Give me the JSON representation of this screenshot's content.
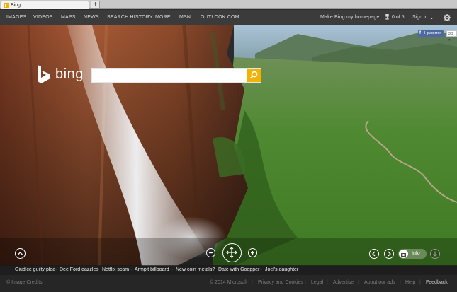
{
  "browser": {
    "tab_title": "Bing",
    "new_tab_label": "+"
  },
  "nav": {
    "items": [
      "IMAGES",
      "VIDEOS",
      "MAPS",
      "NEWS",
      "SEARCH HISTORY",
      "MORE",
      "MSN",
      "OUTLOOK.COM"
    ],
    "homepage_link": "Make Bing my homepage",
    "rewards": "0 of 5",
    "signin": "Sign in",
    "signin_chevron": "⌄",
    "settings_icon": "gear-icon"
  },
  "logo": {
    "word": "bing"
  },
  "search": {
    "value": "",
    "placeholder": ""
  },
  "social": {
    "fb_label": "Нравится",
    "fb_count": "3,9 т"
  },
  "controls": {
    "info_label": "Info"
  },
  "headlines": [
    "Giudice guilty plea",
    "Dee Ford dazzles",
    "Netflix scam",
    "Armpit billboard",
    "New coin metals?",
    "Date with Goepper",
    "Joel's daughter"
  ],
  "footer": {
    "image_credits": "© Image Credits",
    "links": [
      "© 2014 Microsoft",
      "Privacy and Cookies",
      "Legal",
      "Advertise",
      "About our ads",
      "Help"
    ],
    "feedback": "Feedback"
  },
  "colors": {
    "nav_bg": "#3b3b3b",
    "accent": "#f3b200",
    "footer_bg": "#262626",
    "facebook": "#4e69a2"
  }
}
